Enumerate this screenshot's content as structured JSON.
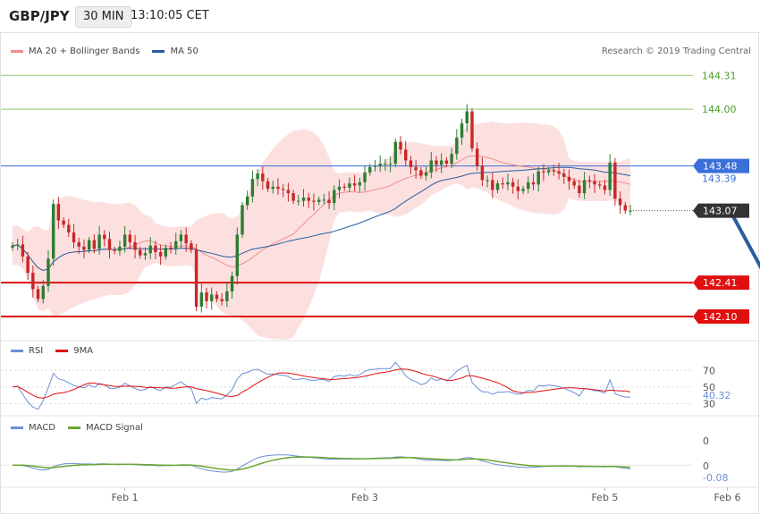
{
  "header": {
    "symbol": "GBP/JPY",
    "timeframe": "30 MIN",
    "time": "13:10:05 CET"
  },
  "copyright": "Research © 2019 Trading Central",
  "colors": {
    "bull": "#2e7d32",
    "bear": "#c62828",
    "ma20": "#f28c8c",
    "band_fill": "#fbd6d6",
    "ma50": "#2a5d9f",
    "rsi": "#6a8fd8",
    "rsi_ma": "#e01010",
    "macd": "#6a8fd8",
    "signal": "#6aa832",
    "green_level": "#8fc971",
    "red_level": "#e01010",
    "blue_level": "#3a6ed8",
    "last_price": "#333333",
    "arrow": "#2a5d9f"
  },
  "chart_data": [
    {
      "type": "candlestick",
      "title": "",
      "legend": [
        {
          "name": "MA 20 + Bollinger Bands",
          "color": "#f28c8c"
        },
        {
          "name": "MA 50",
          "color": "#2a5d9f"
        }
      ],
      "ylim": [
        141.87,
        144.46
      ],
      "x_labels": [
        {
          "label": "Feb 1",
          "index": 22
        },
        {
          "label": "Feb 3",
          "index": 69
        },
        {
          "label": "Feb 5",
          "index": 116
        },
        {
          "label": "Feb 6",
          "index": 140
        }
      ],
      "levels": [
        {
          "label": "144.31",
          "value": 144.31,
          "kind": "green"
        },
        {
          "label": "144.00",
          "value": 144.0,
          "kind": "green"
        },
        {
          "label": "143.48",
          "value": 143.48,
          "kind": "blue"
        },
        {
          "label": "143.39",
          "value": 143.39,
          "kind": "blue_text"
        },
        {
          "label": "143.07",
          "value": 143.07,
          "kind": "last"
        },
        {
          "label": "142.41",
          "value": 142.41,
          "kind": "red"
        },
        {
          "label": "142.10",
          "value": 142.1,
          "kind": "red"
        }
      ],
      "projection": {
        "from_index": 140,
        "from_value": 143.07,
        "to_index": 153,
        "to_value": 142.12
      },
      "ohlc_close": [
        142.75,
        142.76,
        142.65,
        142.5,
        142.35,
        142.26,
        142.38,
        142.63,
        143.13,
        142.98,
        142.94,
        142.87,
        142.78,
        142.74,
        142.71,
        142.8,
        142.72,
        142.85,
        142.81,
        142.71,
        142.7,
        142.74,
        142.85,
        142.78,
        142.71,
        142.66,
        142.68,
        142.75,
        142.69,
        142.65,
        142.73,
        142.72,
        142.79,
        142.85,
        142.77,
        142.71,
        142.19,
        142.32,
        142.24,
        142.3,
        142.26,
        142.24,
        142.33,
        142.47,
        142.85,
        143.12,
        143.2,
        143.36,
        143.41,
        143.34,
        143.27,
        143.29,
        143.27,
        143.26,
        143.23,
        143.16,
        143.16,
        143.19,
        143.16,
        143.15,
        143.17,
        143.17,
        143.14,
        143.26,
        143.29,
        143.28,
        143.32,
        143.3,
        143.33,
        143.42,
        143.47,
        143.48,
        143.5,
        143.5,
        143.5,
        143.7,
        143.63,
        143.53,
        143.47,
        143.44,
        143.39,
        143.42,
        143.53,
        143.49,
        143.53,
        143.5,
        143.59,
        143.74,
        143.87,
        143.98,
        143.64,
        143.48,
        143.35,
        143.35,
        143.26,
        143.32,
        143.31,
        143.33,
        143.29,
        143.25,
        143.27,
        143.33,
        143.31,
        143.43,
        143.42,
        143.44,
        143.43,
        143.41,
        143.38,
        143.34,
        143.3,
        143.23,
        143.35,
        143.34,
        143.31,
        143.3,
        143.26,
        143.51,
        143.18,
        143.12,
        143.07,
        143.07
      ],
      "rsi": {
        "name": "RSI",
        "ma_name": "9MA",
        "ticks": [
          70,
          50,
          30
        ],
        "last": 40.32,
        "range": [
          25,
          80
        ]
      },
      "macd": {
        "name": "MACD",
        "signal_name": "MACD Signal",
        "ticks": [
          "0",
          "0"
        ],
        "last": "-0.08",
        "range": [
          -0.35,
          0.55
        ]
      }
    }
  ]
}
